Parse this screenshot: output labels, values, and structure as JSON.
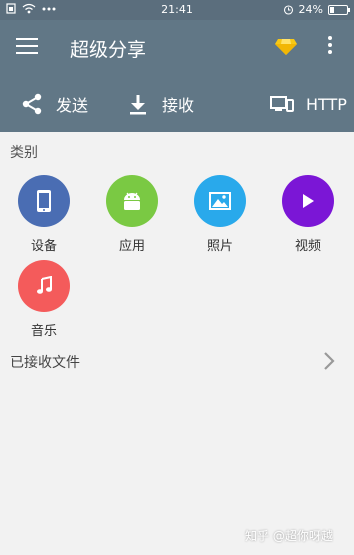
{
  "status_bar": {
    "time": "21:41",
    "battery_text": "24%",
    "battery_level": 0.24
  },
  "app_bar": {
    "title": "超级分享"
  },
  "actions": {
    "send": "发送",
    "receive": "接收",
    "http": "HTTP"
  },
  "categories_section": {
    "title": "类别",
    "items": [
      {
        "label": "设备",
        "icon": "phone-icon",
        "color": "#4a6db3"
      },
      {
        "label": "应用",
        "icon": "android-icon",
        "color": "#7ac943"
      },
      {
        "label": "照片",
        "icon": "image-icon",
        "color": "#29a9eb"
      },
      {
        "label": "视频",
        "icon": "play-icon",
        "color": "#7b16d6"
      },
      {
        "label": "音乐",
        "icon": "music-note-icon",
        "color": "#f45b5b"
      }
    ]
  },
  "received_files": {
    "label": "已接收文件"
  },
  "watermark": "知乎 @超你呀越"
}
